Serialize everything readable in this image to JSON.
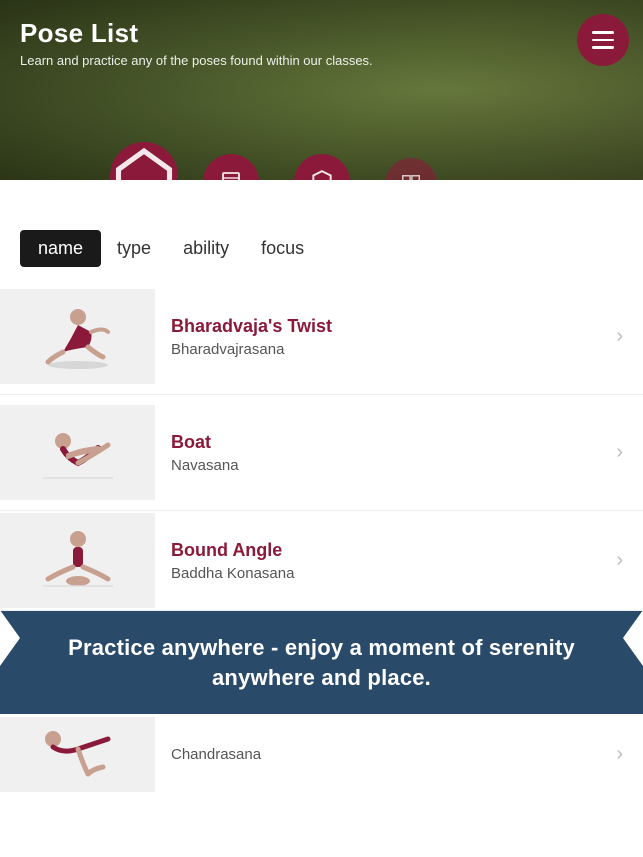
{
  "header": {
    "title": "Pose List",
    "subtitle": "Learn and practice any of the poses found within our classes.",
    "menu_label": "Menu"
  },
  "nav": {
    "circles": [
      {
        "icon": "home-icon",
        "label": "Home"
      },
      {
        "icon": "bookmark-icon",
        "label": "Bookmark"
      },
      {
        "icon": "shield-icon",
        "label": "Shield"
      },
      {
        "icon": "grid-icon",
        "label": "Grid"
      }
    ]
  },
  "sort_tabs": [
    {
      "label": "name",
      "active": true
    },
    {
      "label": "type",
      "active": false
    },
    {
      "label": "ability",
      "active": false
    },
    {
      "label": "focus",
      "active": false
    }
  ],
  "poses": [
    {
      "name_en": "Bharadvaja's Twist",
      "name_san": "Bharadvajrasana",
      "figure": "twist"
    },
    {
      "name_en": "Boat",
      "name_san": "Navasana",
      "figure": "boat"
    },
    {
      "name_en": "Bound Angle",
      "name_san": "Baddha Konasana",
      "figure": "bound"
    }
  ],
  "promo": {
    "text": "Practice anywhere - enjoy a moment of serenity anywhere and place."
  },
  "bottom_pose": {
    "name_san": "Chandrasana"
  }
}
